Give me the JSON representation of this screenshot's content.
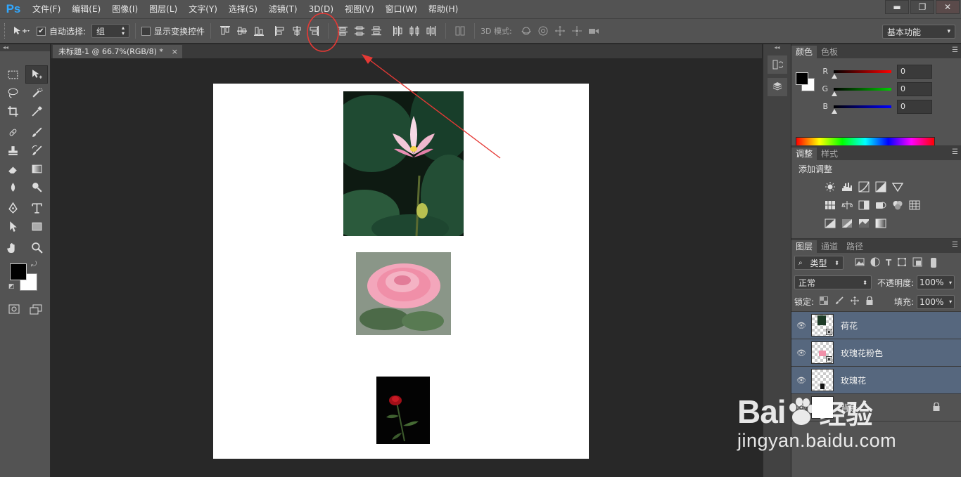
{
  "app": {
    "logo": "Ps"
  },
  "menu": [
    "文件(F)",
    "编辑(E)",
    "图像(I)",
    "图层(L)",
    "文字(Y)",
    "选择(S)",
    "滤镜(T)",
    "3D(D)",
    "视图(V)",
    "窗口(W)",
    "帮助(H)"
  ],
  "window_controls": {
    "minimize": "▬",
    "restore": "❐",
    "close": "✕"
  },
  "options": {
    "auto_select_label": "自动选择:",
    "auto_select_checked": true,
    "auto_select_value": "组",
    "show_transform_label": "显示变换控件",
    "show_transform_checked": false,
    "mode_3d_label": "3D 模式:",
    "workspace_preset": "基本功能"
  },
  "document": {
    "tab_title": "未标题-1 @ 66.7%(RGB/8) *",
    "close": "×"
  },
  "color_panel": {
    "tabs": [
      "颜色",
      "色板"
    ],
    "channels": [
      {
        "label": "R",
        "value": "0",
        "color": "#ff0000"
      },
      {
        "label": "G",
        "value": "0",
        "color": "#00cc00"
      },
      {
        "label": "B",
        "value": "0",
        "color": "#0000ff"
      }
    ],
    "foreground": "#000000",
    "background": "#ffffff"
  },
  "adjust_panel": {
    "tabs": [
      "调整",
      "样式"
    ],
    "title": "添加调整"
  },
  "layers_panel": {
    "tabs": [
      "图层",
      "通道",
      "路径"
    ],
    "filter_kind": "类型",
    "blend_mode": "正常",
    "opacity_label": "不透明度:",
    "opacity": "100%",
    "lock_label": "锁定:",
    "fill_label": "填充:",
    "fill": "100%",
    "layers": [
      {
        "name": "荷花",
        "selected": true,
        "locked": false,
        "thumb": "lotus"
      },
      {
        "name": "玫瑰花粉色",
        "selected": true,
        "locked": false,
        "thumb": "pinkrose"
      },
      {
        "name": "玫瑰花",
        "selected": true,
        "locked": false,
        "thumb": "redrose"
      },
      {
        "name": "背景",
        "selected": false,
        "locked": true,
        "thumb": "white"
      }
    ]
  },
  "watermark": {
    "brand_left": "Bai",
    "brand_right": "经验",
    "url": "jingyan.baidu.com"
  }
}
